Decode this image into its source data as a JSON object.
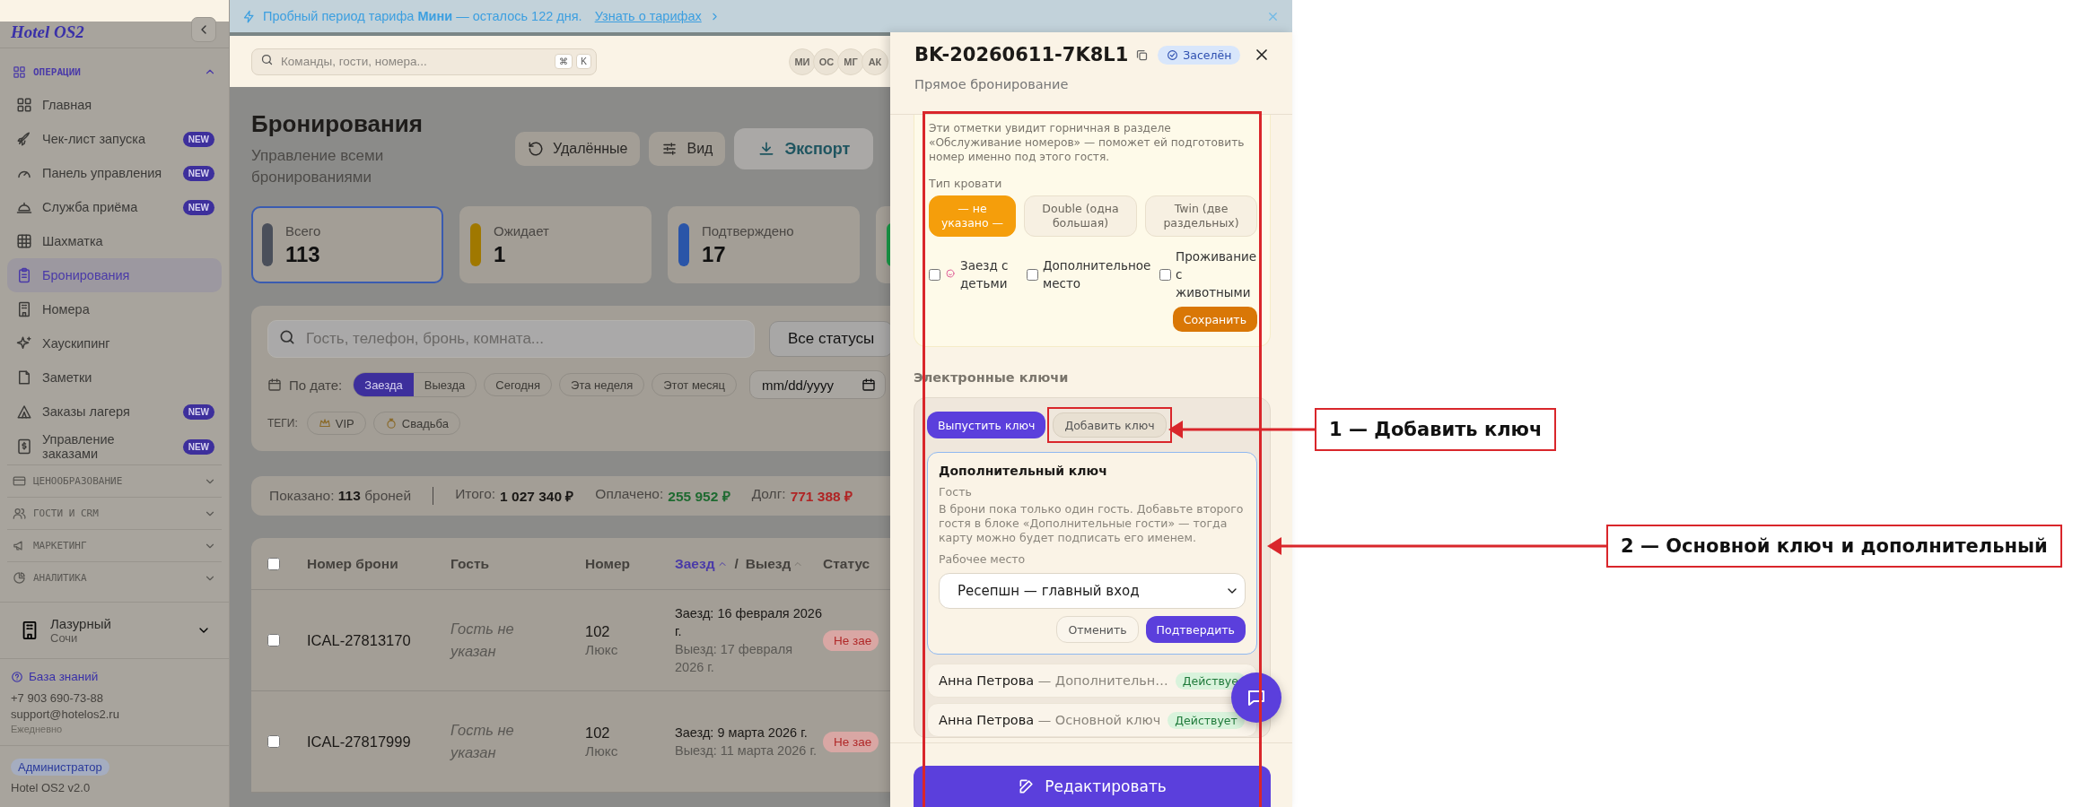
{
  "banner": {
    "text": "Пробный период тарифа **Мини** — осталось 122 дня.",
    "link": "Узнать о тарифах"
  },
  "sidebar": {
    "logo": "Hotel OS2",
    "sections": [
      {
        "title": "ОПЕРАЦИИ",
        "expanded": true,
        "items": [
          {
            "label": "Главная",
            "selected": false
          },
          {
            "label": "Чек-лист запуска",
            "badge": "NEW",
            "selected": false
          },
          {
            "label": "Панель управления",
            "badge": "NEW",
            "selected": false
          },
          {
            "label": "Служба приёма",
            "badge": "NEW",
            "selected": false
          },
          {
            "label": "Шахматка",
            "selected": false
          },
          {
            "label": "Бронирования",
            "selected": true
          },
          {
            "label": "Номера",
            "selected": false
          },
          {
            "label": "Хаускипинг",
            "selected": false
          },
          {
            "label": "Заметки",
            "selected": false
          },
          {
            "label": "Заказы лагеря",
            "badge": "NEW",
            "selected": false
          },
          {
            "label": "Управление заказами",
            "badge": "NEW",
            "selected": false
          }
        ]
      },
      {
        "title": "ЦЕНООБРАЗОВАНИЕ",
        "expanded": false
      },
      {
        "title": "ГОСТИ И CRM",
        "expanded": false
      },
      {
        "title": "МАРКЕТИНГ",
        "expanded": false
      },
      {
        "title": "АНАЛИТИКА",
        "expanded": false
      }
    ],
    "property": {
      "name": "Лазурный",
      "city": "Сочи"
    },
    "help": {
      "link": "База знаний",
      "phone": "+7 903 690-73-88",
      "email": "support@hotelos2.ru",
      "hours": "Ежедневно"
    },
    "role": "Администратор",
    "version": "Hotel OS2 v2.0"
  },
  "topbar": {
    "search_placeholder": "Команды, гости, номера...",
    "shortcut": [
      "⌘",
      "K"
    ],
    "avatars": [
      "МИ",
      "ОС",
      "МГ",
      "АК"
    ]
  },
  "page": {
    "title": "Бронирования",
    "subtitle": "Управление всеми бронированиями",
    "actions": [
      {
        "label": "Удалённые",
        "kind": "secondary"
      },
      {
        "label": "Вид",
        "kind": "secondary"
      },
      {
        "label": "Экспорт",
        "kind": "primary"
      }
    ],
    "stats": [
      {
        "label": "Всего",
        "value": "113",
        "color": "#4a4f5a",
        "selected": true
      },
      {
        "label": "Ожидает",
        "value": "1",
        "color": "#a07800",
        "selected": false
      },
      {
        "label": "Подтверждено",
        "value": "17",
        "color": "#2a55a8",
        "selected": false
      },
      {
        "color": "#1a9a48",
        "selected": false
      }
    ]
  },
  "filters": {
    "search_placeholder": "Гость, телефон, бронь, комната...",
    "status": "Все статусы",
    "date_label": "По дате:",
    "date_modes": [
      {
        "label": "Заезда",
        "selected": true
      },
      {
        "label": "Выезда",
        "selected": false
      }
    ],
    "presets": [
      "Сегодня",
      "Эта неделя",
      "Этот месяц"
    ],
    "date_placeholder": "mm/dd/yyyy",
    "tags_label": "ТЕГИ:",
    "tags": [
      {
        "label": "VIP"
      },
      {
        "label": "Свадьба"
      }
    ]
  },
  "summary": {
    "shown": "Показано: **113** броней",
    "totals": [
      {
        "label": "Итого:",
        "value": "1 027 340 ₽",
        "kind": "total"
      },
      {
        "label": "Оплачено:",
        "value": "255 952 ₽",
        "kind": "paid"
      },
      {
        "label": "Долг:",
        "value": "771 388 ₽",
        "kind": "debt"
      }
    ]
  },
  "table": {
    "checked": false,
    "columns": [
      {
        "label": "Номер брони"
      },
      {
        "label": "Гость"
      },
      {
        "label": "Номер"
      },
      {
        "separator": "/",
        "sort_options": [
          {
            "label": "Заезд",
            "selected": true
          },
          {
            "label": "Выезд",
            "selected": false
          }
        ]
      },
      {
        "label": "Статус"
      }
    ],
    "rows": [
      {
        "checked": false,
        "booking": "ICAL-27813170",
        "guest": "Гость не указан",
        "room": "102",
        "room_type": "Люкс",
        "checkin": "Заезд: 16 февраля 2026 г.",
        "checkout": "Выезд: 17 февраля 2026 г.",
        "status": "Не зае"
      },
      {
        "checked": false,
        "booking": "ICAL-27817999",
        "guest": "Гость не указан",
        "room": "102",
        "room_type": "Люкс",
        "checkin": "Заезд: 9 марта 2026 г.",
        "checkout": "Выезд: 11 марта 2026 г.",
        "status": "Не зае"
      }
    ]
  },
  "drawer": {
    "title": "BK-20260611-7K8L1",
    "status": "Заселён",
    "subtitle": "Прямое бронирование",
    "housekeeping": {
      "note": "Эти отметки увидит горничная в разделе «Обслуживание номеров» — поможет ей подготовить номер именно под этого гостя.",
      "bed_label": "Тип кровати",
      "bed_options": [
        {
          "label": "— не указано —",
          "selected": true
        },
        {
          "label": "Double (одна большая)",
          "selected": false
        },
        {
          "label": "Twin (две раздельных)",
          "selected": false
        }
      ],
      "flags": [
        {
          "label": "Заезд с детьми",
          "checked": false
        },
        {
          "label": "Дополнительное место",
          "checked": false
        },
        {
          "label": "Проживание с животными",
          "checked": false
        }
      ],
      "save": "Сохранить"
    },
    "keys": {
      "title": "Электронные ключи",
      "issue": "Выпустить ключ",
      "add": "Добавить ключ",
      "form": {
        "title": "Дополнительный ключ",
        "guest_label": "Гость",
        "guest_note": "В брони пока только один гость. Добавьте второго гостя в блоке «Дополнительные гости» — тогда карту можно будет подписать его именем.",
        "workplace_label": "Рабочее место",
        "workplace": "Ресепшн — главный вход",
        "cancel": "Отменить",
        "confirm": "Подтвердить"
      },
      "list": [
        {
          "name": "Анна Петрова",
          "type": "— Дополнительн…",
          "status": "Действуе"
        },
        {
          "name": "Анна Петрова",
          "type": "— Основной ключ",
          "status": "Действует"
        }
      ]
    },
    "edit": "Редактировать"
  },
  "annotations": [
    {
      "label": "1 — Добавить ключ"
    },
    {
      "label": "2 — Основной ключ и дополнительный"
    }
  ]
}
